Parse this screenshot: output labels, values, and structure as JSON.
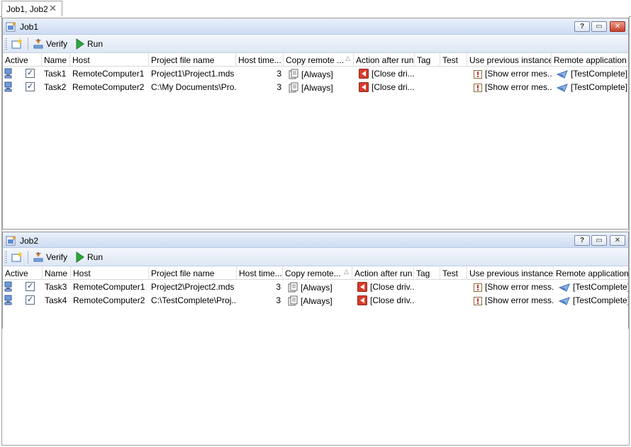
{
  "tab": {
    "label": "Job1, Job2",
    "close_glyph": "✕"
  },
  "toolbar": {
    "verify_label": "Verify",
    "run_label": "Run"
  },
  "columns": [
    "Active",
    "Name",
    "Host",
    "Project file name",
    "Host time...",
    "Copy remote ...",
    "Action after run",
    "Tag",
    "Test",
    "Use previous instance",
    "Remote application"
  ],
  "columns_job2": [
    "Active",
    "Name",
    "Host",
    "Project file name",
    "Host time...",
    "Copy remote...",
    "Action after run",
    "Tag",
    "Test",
    "Use previous instance",
    "Remote application"
  ],
  "jobs": [
    {
      "title": "Job1",
      "rows": [
        {
          "name": "Task1",
          "host": "RemoteComputer1",
          "project": "Project1\\Project1.mds",
          "timeout": "3",
          "copy": "[Always]",
          "action": "[Close dri...",
          "tag": "",
          "test": "",
          "prev": "[Show error mes...",
          "app": "[TestComplete]",
          "checked": true
        },
        {
          "name": "Task2",
          "host": "RemoteComputer2",
          "project": "C:\\My Documents\\Pro...",
          "timeout": "3",
          "copy": "[Always]",
          "action": "[Close dri...",
          "tag": "",
          "test": "",
          "prev": "[Show error mes...",
          "app": "[TestComplete]",
          "checked": true
        }
      ]
    },
    {
      "title": "Job2",
      "rows": [
        {
          "name": "Task3",
          "host": "RemoteComputer1",
          "project": "Project2\\Project2.mds",
          "timeout": "3",
          "copy": "[Always]",
          "action": "[Close driv...",
          "tag": "",
          "test": "",
          "prev": "[Show error mess...",
          "app": "[TestComplete]",
          "checked": true
        },
        {
          "name": "Task4",
          "host": "RemoteComputer2",
          "project": "C:\\TestComplete\\Proj...",
          "timeout": "3",
          "copy": "[Always]",
          "action": "[Close driv...",
          "tag": "",
          "test": "",
          "prev": "[Show error mess...",
          "app": "[TestComplete]",
          "checked": true
        }
      ]
    }
  ],
  "caption_buttons": {
    "help": "?",
    "restore": "▭",
    "close": "✕"
  },
  "checkbox_glyph": "✓",
  "icons": {
    "job": "job-icon",
    "new": "new-task-icon",
    "verify": "verify-icon",
    "run": "run-icon",
    "active": "computer-icon",
    "copy": "documents-icon",
    "action": "close-driver-icon",
    "prev": "error-message-icon",
    "app": "testcomplete-icon"
  },
  "colors": {
    "caption_top": "#eaf1fb",
    "caption_bottom": "#cddcf2",
    "run_green": "#2ea83a",
    "action_red": "#d83a2a",
    "close_button_red": "#c8402c"
  }
}
